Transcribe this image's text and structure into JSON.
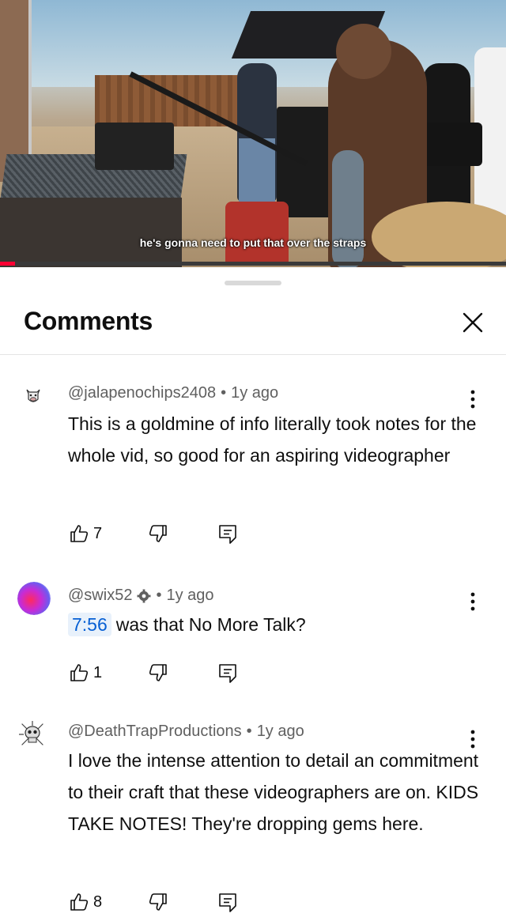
{
  "video": {
    "caption": "he's gonna need to put that over the straps",
    "progress_fraction": 0.03
  },
  "comments_panel": {
    "title": "Comments",
    "close_icon": "close-icon"
  },
  "comments": [
    {
      "handle": "@jalapenochips2408",
      "time": "1y ago",
      "text": "This is a goldmine of info literally took notes for the whole vid, so good for an aspiring videographer",
      "likes": "7",
      "verified": false
    },
    {
      "handle": "@swix52",
      "time": "1y ago",
      "timestamp_link": "7:56",
      "text": "was that No More Talk?",
      "likes": "1",
      "verified": true
    },
    {
      "handle": "@DeathTrapProductions",
      "time": "1y ago",
      "text": "I love the intense attention to detail an commitment to their craft that these videographers are on. KIDS TAKE NOTES! They're dropping gems here.",
      "likes": "8",
      "verified": false
    }
  ],
  "separator": "•",
  "colors": {
    "accent_red": "#ff0033",
    "link_blue": "#065fd4",
    "secondary_text": "#606060"
  }
}
